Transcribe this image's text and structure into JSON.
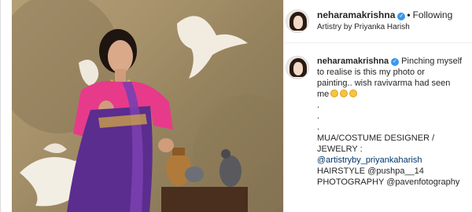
{
  "header": {
    "username": "neharamakrishna",
    "separator": "•",
    "follow_status": "Following",
    "location": "Artistry by Priyanka Harish"
  },
  "caption": {
    "username": "neharamakrishna",
    "text_lines": [
      "Pinching myself",
      "to realise is this my photo or",
      "painting.. wish ravivarma had seen",
      "me"
    ],
    "dots": [
      ".",
      ".",
      "."
    ],
    "credits": [
      "MUA/COSTUME DESIGNER /",
      "JEWELRY :",
      "@artistryby_priyankaharish",
      "HAIRSTYLE @pushpa__14",
      "PHOTOGRAPHY @pavenfotography"
    ]
  },
  "colors": {
    "verified": "#3897f0",
    "link": "#003569",
    "saree": "#5b2d8e",
    "blouse": "#e83a8a"
  },
  "icons": {
    "verified": "verified-badge-icon",
    "emoji": "emoji-icon"
  }
}
